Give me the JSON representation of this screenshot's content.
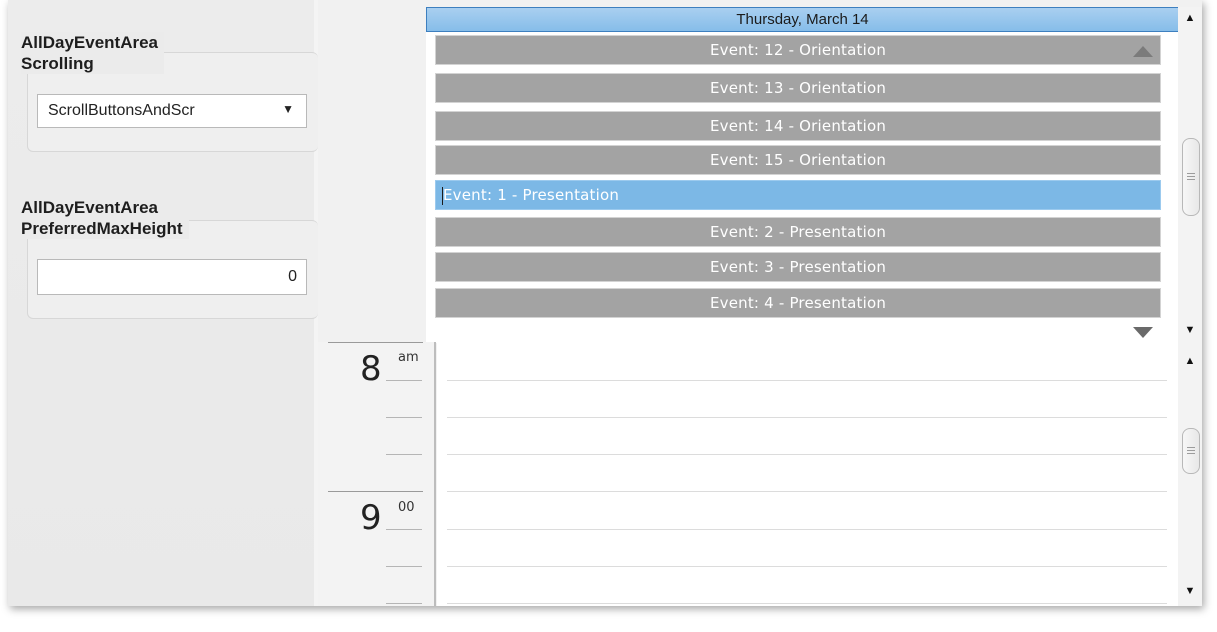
{
  "settings": {
    "scrolling": {
      "label_line1": "AllDayEventArea",
      "label_line2": "Scrolling",
      "selected_value": "ScrollButtonsAndScr"
    },
    "max_height": {
      "label_line1": "AllDayEventArea",
      "label_line2": "PreferredMaxHeight",
      "value": "0"
    }
  },
  "scheduler": {
    "date_header": "Thursday, March 14",
    "all_day_events": [
      {
        "label": "Event: 12 - Orientation",
        "selected": false
      },
      {
        "label": "Event: 13 - Orientation",
        "selected": false
      },
      {
        "label": "Event: 14 - Orientation",
        "selected": false
      },
      {
        "label": "Event: 15 - Orientation",
        "selected": false
      },
      {
        "label": "Event: 1 - Presentation",
        "selected": true
      },
      {
        "label": "Event: 2 - Presentation",
        "selected": false
      },
      {
        "label": "Event: 3 - Presentation",
        "selected": false
      },
      {
        "label": "Event: 4 - Presentation",
        "selected": false
      }
    ],
    "time_rows": [
      {
        "hour": "8",
        "suffix": "am"
      },
      {
        "hour": "9",
        "suffix": "00"
      }
    ]
  },
  "icons": {
    "dropdown": "chevron-down-icon",
    "scroll_up": "triangle-up-icon",
    "scroll_down": "triangle-down-icon"
  }
}
